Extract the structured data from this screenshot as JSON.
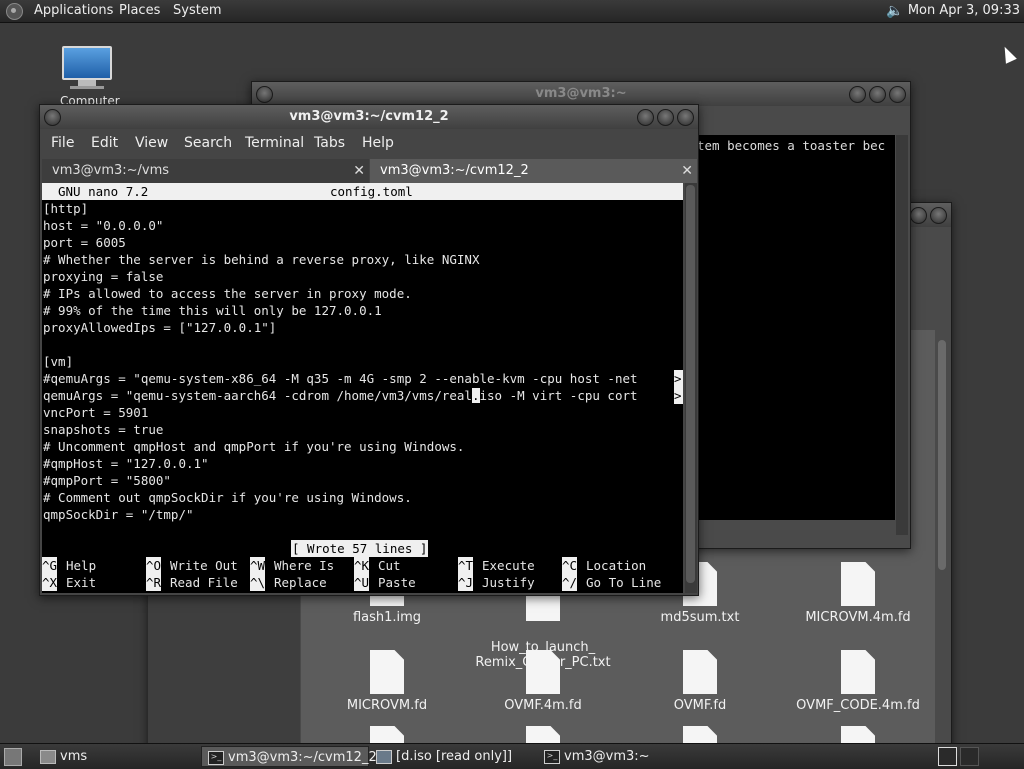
{
  "top_panel": {
    "menus": [
      "Applications",
      "Places",
      "System"
    ],
    "clock": "Mon Apr  3, 09:33"
  },
  "desktop": {
    "computer_label": "Computer"
  },
  "back_window": {
    "title": "vm3@vm3:~",
    "visible_text": "tem becomes a toaster bec"
  },
  "file_manager": {
    "files": [
      {
        "name": "flash1.img"
      },
      {
        "name": "How_to_launch_\nRemix_OS_for_PC.txt"
      },
      {
        "name": "md5sum.txt"
      },
      {
        "name": "MICROVM.4m.fd"
      },
      {
        "name": "MICROVM.fd"
      },
      {
        "name": "OVMF.4m.fd"
      },
      {
        "name": "OVMF.fd"
      },
      {
        "name": "OVMF_CODE.4m.fd"
      }
    ]
  },
  "terminal": {
    "title": "vm3@vm3:~/cvm12_2",
    "menu": [
      "File",
      "Edit",
      "View",
      "Search",
      "Terminal",
      "Tabs",
      "Help"
    ],
    "tabs": [
      {
        "label": "vm3@vm3:~/vms"
      },
      {
        "label": "vm3@vm3:~/cvm12_2"
      }
    ],
    "nano": {
      "version": "GNU nano 7.2",
      "filename": "config.toml",
      "lines": [
        "[http]",
        "host = \"0.0.0.0\"",
        "port = 6005",
        "# Whether the server is behind a reverse proxy, like NGINX",
        "proxying = false",
        "# IPs allowed to access the server in proxy mode.",
        "# 99% of the time this will only be 127.0.0.1",
        "proxyAllowedIps = [\"127.0.0.1\"]",
        "",
        "[vm]",
        "#qemuArgs = \"qemu-system-x86_64 -M q35 -m 4G -smp 2 --enable-kvm -cpu host -net",
        "qemuArgs = \"qemu-system-aarch64 -cdrom /home/vm3/vms/real",
        "vncPort = 5901",
        "snapshots = true",
        "# Uncomment qmpHost and qmpPort if you're using Windows.",
        "#qmpHost = \"127.0.0.1\"",
        "#qmpPort = \"5800\"",
        "# Comment out qmpSockDir if you're using Windows.",
        "qmpSockDir = \"/tmp/\""
      ],
      "cursor_char": ".",
      "line_after_cursor": "iso -M virt -cpu cort",
      "status": "[ Wrote 57 lines ]",
      "shortcuts_row1": [
        {
          "key": "^G",
          "label": "Help"
        },
        {
          "key": "^O",
          "label": "Write Out"
        },
        {
          "key": "^W",
          "label": "Where Is"
        },
        {
          "key": "^K",
          "label": "Cut"
        },
        {
          "key": "^T",
          "label": "Execute"
        },
        {
          "key": "^C",
          "label": "Location"
        }
      ],
      "shortcuts_row2": [
        {
          "key": "^X",
          "label": "Exit"
        },
        {
          "key": "^R",
          "label": "Read File"
        },
        {
          "key": "^\\",
          "label": "Replace"
        },
        {
          "key": "^U",
          "label": "Paste"
        },
        {
          "key": "^J",
          "label": "Justify"
        },
        {
          "key": "^/",
          "label": "Go To Line"
        }
      ],
      "truncation_marker": ">"
    }
  },
  "taskbar": {
    "items": [
      {
        "label": "vms"
      },
      {
        "label": "vm3@vm3:~/cvm12_2"
      },
      {
        "label": "[d.iso [read only]]"
      },
      {
        "label": "vm3@vm3:~"
      }
    ]
  }
}
